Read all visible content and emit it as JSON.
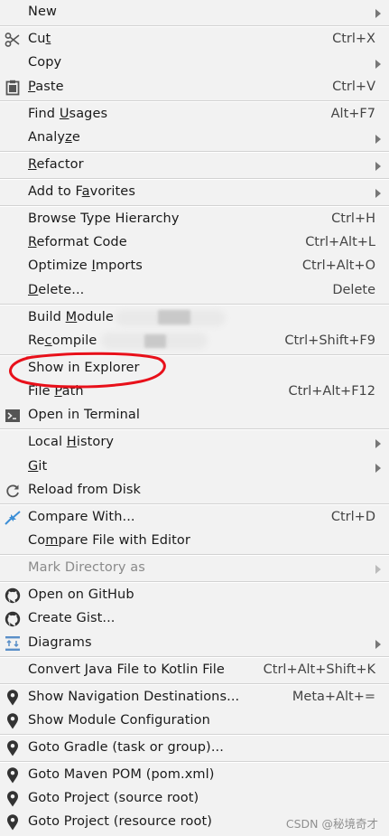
{
  "menu": {
    "new": {
      "label": "New"
    },
    "cut": {
      "pre": "Cu",
      "ul": "t",
      "post": "",
      "shortcut": "Ctrl+X"
    },
    "copy": {
      "label": "Copy"
    },
    "paste": {
      "pre": "",
      "ul": "P",
      "post": "aste",
      "shortcut": "Ctrl+V"
    },
    "find_usages": {
      "pre": "Find ",
      "ul": "U",
      "post": "sages",
      "shortcut": "Alt+F7"
    },
    "analyze": {
      "pre": "Analy",
      "ul": "z",
      "post": "e"
    },
    "refactor": {
      "pre": "",
      "ul": "R",
      "post": "efactor"
    },
    "add_to_favorites": {
      "pre": "Add to F",
      "ul": "a",
      "post": "vorites"
    },
    "browse_type_hierarchy": {
      "label": "Browse Type Hierarchy",
      "shortcut": "Ctrl+H"
    },
    "reformat_code": {
      "pre": "",
      "ul": "R",
      "post": "eformat Code",
      "shortcut": "Ctrl+Alt+L"
    },
    "optimize_imports": {
      "pre": "Optimize ",
      "ul": "I",
      "post": "mports",
      "shortcut": "Ctrl+Alt+O"
    },
    "delete": {
      "pre": "",
      "ul": "D",
      "post": "elete...",
      "shortcut": "Delete"
    },
    "build_module": {
      "pre": "Build ",
      "ul": "M",
      "post": "odule"
    },
    "recompile": {
      "pre": "Re",
      "ul": "c",
      "post": "ompile",
      "shortcut": "Ctrl+Shift+F9"
    },
    "show_in_explorer": {
      "label": "Show in Explorer"
    },
    "file_path": {
      "pre": "File ",
      "ul": "P",
      "post": "ath",
      "shortcut": "Ctrl+Alt+F12"
    },
    "open_in_terminal": {
      "label": "Open in Terminal"
    },
    "local_history": {
      "pre": "Local ",
      "ul": "H",
      "post": "istory"
    },
    "git": {
      "pre": "",
      "ul": "G",
      "post": "it"
    },
    "reload_from_disk": {
      "label": "Reload from Disk"
    },
    "compare_with": {
      "label": "Compare With...",
      "shortcut": "Ctrl+D"
    },
    "compare_file_with_editor": {
      "pre": "Co",
      "ul": "m",
      "post": "pare File with Editor"
    },
    "mark_directory_as": {
      "label": "Mark Directory as"
    },
    "open_on_github": {
      "label": "Open on GitHub"
    },
    "create_gist": {
      "label": "Create Gist..."
    },
    "diagrams": {
      "label": "Diagrams"
    },
    "convert_java_to_kotlin": {
      "label": "Convert Java File to Kotlin File",
      "shortcut": "Ctrl+Alt+Shift+K"
    },
    "show_navigation_destinations": {
      "label": "Show Navigation Destinations...",
      "shortcut": "Meta+Alt+="
    },
    "show_module_configuration": {
      "label": "Show Module Configuration"
    },
    "goto_gradle": {
      "label": "Goto Gradle (task or group)..."
    },
    "goto_maven_pom": {
      "label": "Goto Maven POM (pom.xml)"
    },
    "goto_project_source": {
      "label": "Goto Project (source root)"
    },
    "goto_project_resource": {
      "label": "Goto Project (resource root)"
    }
  },
  "watermark": "CSDN @秘境奇才",
  "colors": {
    "background": "#f2f2f2",
    "annotation": "#e8101a",
    "compare_icon": "#3d8fd6",
    "diagram_icon": "#5a8fc8"
  },
  "icons": [
    "scissors-icon",
    "clipboard-icon",
    "terminal-icon",
    "reload-icon",
    "compare-arrows-icon",
    "github-icon",
    "diagram-icon",
    "location-pin-icon",
    "submenu-arrow-icon"
  ]
}
